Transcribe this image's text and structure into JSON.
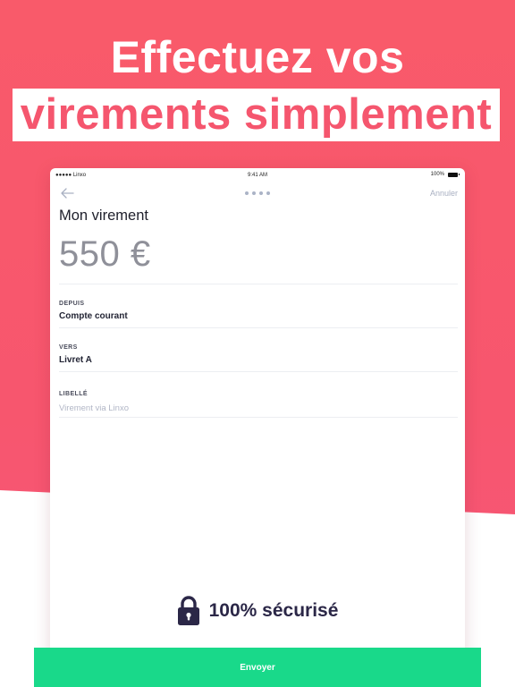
{
  "headline": {
    "line1": "Effectuez vos",
    "line2": "virements simplement"
  },
  "statusbar": {
    "carrier": "●●●●● Linxo",
    "time": "9:41 AM",
    "battery": "100%"
  },
  "navbar": {
    "cancel_label": "Annuler"
  },
  "form": {
    "title": "Mon virement",
    "amount": "550 €",
    "from_label": "DEPUIS",
    "from_value": "Compte courant",
    "to_label": "VERS",
    "to_value": "Livret A",
    "label_label": "LIBELLÉ",
    "label_placeholder": "Virement via Linxo"
  },
  "secure": {
    "text": "100% sécurisé"
  },
  "actions": {
    "send_label": "Envoyer"
  },
  "colors": {
    "brand_pink": "#f7566e",
    "send_green": "#19d98a",
    "secure_text": "#2b2747"
  }
}
